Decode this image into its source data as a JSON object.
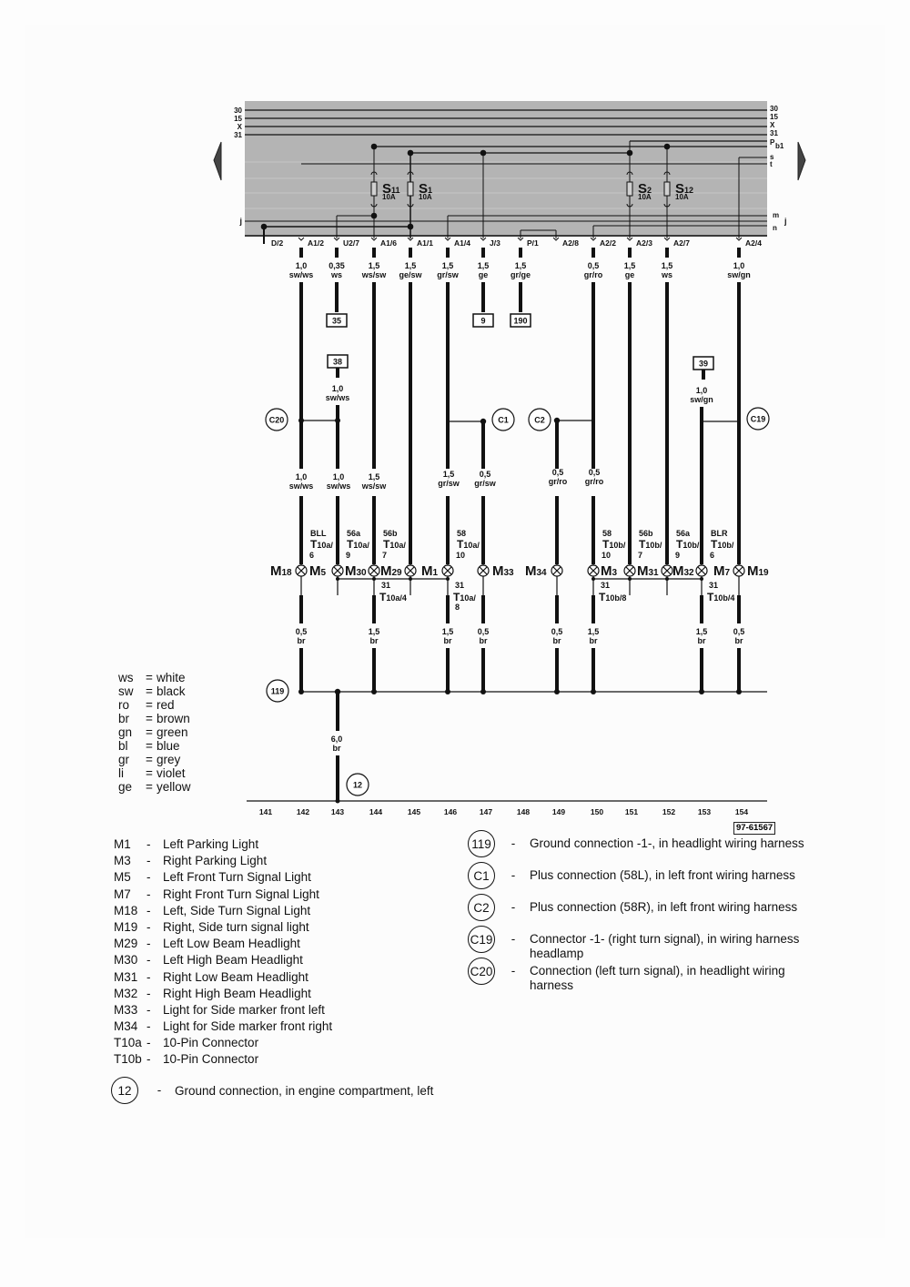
{
  "diagram": {
    "reference": "97-61567",
    "bus_left_labels": [
      "30",
      "15",
      "X",
      "31"
    ],
    "bus_left_j": "j",
    "bus_right_labels": [
      "30",
      "15",
      "X",
      "31"
    ],
    "bus_right_extra": [
      "P",
      "b1",
      "s",
      "t",
      "m",
      "j",
      "n"
    ],
    "fuses": [
      {
        "id": "S11",
        "name": "S",
        "sub": "11",
        "rating": "10A"
      },
      {
        "id": "S1",
        "name": "S",
        "sub": "1",
        "rating": "10A"
      },
      {
        "id": "S2",
        "name": "S",
        "sub": "2",
        "rating": "10A"
      },
      {
        "id": "S12",
        "name": "S",
        "sub": "12",
        "rating": "10A"
      }
    ],
    "terminals": [
      {
        "label": "D/2"
      },
      {
        "label": "A1/2",
        "size": "1,0",
        "color": "sw/ws"
      },
      {
        "label": "U2/7",
        "size": "0,35",
        "color": "ws"
      },
      {
        "label": "A1/6",
        "size": "1,5",
        "color": "ws/sw"
      },
      {
        "label": "A1/1",
        "size": "1,5",
        "color": "ge/sw"
      },
      {
        "label": "A1/4",
        "size": "1,5",
        "color": "gr/sw"
      },
      {
        "label": "J/3",
        "size": "1,5",
        "color": "ge"
      },
      {
        "label": "P/1",
        "size": "1,5",
        "color": "gr/ge"
      },
      {
        "label": "A2/8"
      },
      {
        "label": "A2/2",
        "size": "0,5",
        "color": "gr/ro"
      },
      {
        "label": "A2/3",
        "size": "1,5",
        "color": "ge"
      },
      {
        "label": "A2/7",
        "size": "1,5",
        "color": "ws"
      },
      {
        "label": "A2/4",
        "size": "1,0",
        "color": "sw/gn"
      }
    ],
    "ref_boxes": [
      "35",
      "9",
      "190",
      "38",
      "39"
    ],
    "wire_38": {
      "size": "1,0",
      "color": "sw/ws"
    },
    "wire_39": {
      "size": "1,0",
      "color": "sw/gn"
    },
    "connectors": [
      "C20",
      "C1",
      "C2",
      "C19",
      "119",
      "12"
    ],
    "mid_wires": [
      {
        "size": "1,0",
        "color": "sw/ws"
      },
      {
        "size": "1,0",
        "color": "sw/ws"
      },
      {
        "size": "1,5",
        "color": "ws/sw"
      },
      {
        "size": "1,5",
        "color": "gr/sw"
      },
      {
        "size": "0,5",
        "color": "gr/sw"
      },
      {
        "size": "0,5",
        "color": "gr/ro"
      },
      {
        "size": "0,5",
        "color": "gr/ro"
      }
    ],
    "pins": [
      {
        "term": "BLL",
        "conn": "T10a/",
        "pin": "6"
      },
      {
        "term": "56a",
        "conn": "T10a/",
        "pin": "9"
      },
      {
        "term": "56b",
        "conn": "T10a/",
        "pin": "7"
      },
      {
        "term": "58",
        "conn": "T10a/",
        "pin": "10"
      },
      {
        "term": "58",
        "conn": "T10b/",
        "pin": "10"
      },
      {
        "term": "56b",
        "conn": "T10b/",
        "pin": "7"
      },
      {
        "term": "56a",
        "conn": "T10b/",
        "pin": "9"
      },
      {
        "term": "BLR",
        "conn": "T10b/",
        "pin": "6"
      }
    ],
    "ground_pins": [
      {
        "term": "31",
        "conn": "T10a/4"
      },
      {
        "term": "31",
        "conn": "T10a/",
        "pin": "8"
      },
      {
        "term": "31",
        "conn": "T10b/8"
      },
      {
        "term": "31",
        "conn": "T10b/4"
      }
    ],
    "lamps": [
      {
        "name": "M",
        "sub": "18"
      },
      {
        "name": "M",
        "sub": "5"
      },
      {
        "name": "M",
        "sub": "30"
      },
      {
        "name": "M",
        "sub": "29"
      },
      {
        "name": "M",
        "sub": "1"
      },
      {
        "name": "M",
        "sub": "33"
      },
      {
        "name": "M",
        "sub": "34"
      },
      {
        "name": "M",
        "sub": "3"
      },
      {
        "name": "M",
        "sub": "31"
      },
      {
        "name": "M",
        "sub": "32"
      },
      {
        "name": "M",
        "sub": "7"
      },
      {
        "name": "M",
        "sub": "19"
      }
    ],
    "ground_wires": [
      {
        "size": "0,5",
        "color": "br"
      },
      {
        "size": "1,5",
        "color": "br"
      },
      {
        "size": "1,5",
        "color": "br"
      },
      {
        "size": "0,5",
        "color": "br"
      },
      {
        "size": "0,5",
        "color": "br"
      },
      {
        "size": "1,5",
        "color": "br"
      },
      {
        "size": "1,5",
        "color": "br"
      },
      {
        "size": "0,5",
        "color": "br"
      }
    ],
    "main_ground_wire": {
      "size": "6,0",
      "color": "br"
    },
    "track_numbers": [
      "141",
      "142",
      "143",
      "144",
      "145",
      "146",
      "147",
      "148",
      "149",
      "150",
      "151",
      "152",
      "153",
      "154"
    ]
  },
  "color_legend": [
    {
      "abbr": "ws",
      "name": "white"
    },
    {
      "abbr": "sw",
      "name": "black"
    },
    {
      "abbr": "ro",
      "name": "red"
    },
    {
      "abbr": "br",
      "name": "brown"
    },
    {
      "abbr": "gn",
      "name": "green"
    },
    {
      "abbr": "bl",
      "name": "blue"
    },
    {
      "abbr": "gr",
      "name": "grey"
    },
    {
      "abbr": "li",
      "name": "violet"
    },
    {
      "abbr": "ge",
      "name": "yellow"
    }
  ],
  "component_legend": [
    {
      "code": "M1",
      "desc": "Left Parking Light"
    },
    {
      "code": "M3",
      "desc": "Right Parking Light"
    },
    {
      "code": "M5",
      "desc": "Left Front Turn Signal Light"
    },
    {
      "code": "M7",
      "desc": "Right Front Turn Signal Light"
    },
    {
      "code": "M18",
      "desc": "Left, Side Turn Signal Light"
    },
    {
      "code": "M19",
      "desc": "Right, Side turn signal light"
    },
    {
      "code": "M29",
      "desc": "Left Low Beam Headlight"
    },
    {
      "code": "M30",
      "desc": "Left High Beam Headlight"
    },
    {
      "code": "M31",
      "desc": "Right Low Beam Headlight"
    },
    {
      "code": "M32",
      "desc": "Right High Beam Headlight"
    },
    {
      "code": "M33",
      "desc": "Light for Side marker front left"
    },
    {
      "code": "M34",
      "desc": "Light for Side marker front right"
    },
    {
      "code": "T10a",
      "desc": "10-Pin Connector"
    },
    {
      "code": "T10b",
      "desc": "10-Pin Connector"
    }
  ],
  "ground_legend": {
    "code": "12",
    "desc": "Ground connection, in engine compartment, left"
  },
  "connection_legend": [
    {
      "code": "119",
      "desc": "Ground connection -1-, in headlight  wiring harness"
    },
    {
      "code": "C1",
      "desc": "Plus connection (58L), in left front  wiring harness"
    },
    {
      "code": "C2",
      "desc": "Plus connection (58R), in left front  wiring harness"
    },
    {
      "code": "C19",
      "desc": "Connector -1- (right turn signal),  in wiring harness headlamp"
    },
    {
      "code": "C20",
      "desc": "Connection (left turn signal), in headlight wiring harness"
    }
  ],
  "separator": "-"
}
